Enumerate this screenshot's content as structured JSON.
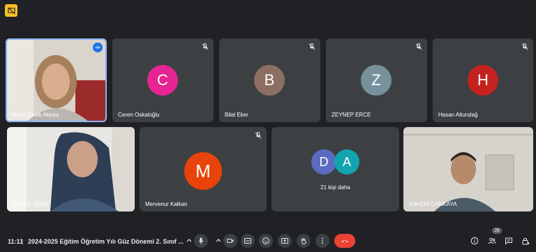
{
  "tiles": [
    {
      "name": "Seher Çevik Aktura"
    },
    {
      "name": "Ceren Oskaloğlu",
      "initial": "C",
      "color": "#e52592"
    },
    {
      "name": "Bilal Eker",
      "initial": "B",
      "color": "#8d6e63"
    },
    {
      "name": "ZEYNEP ERCE",
      "initial": "Z",
      "color": "#78909c"
    },
    {
      "name": "Hasan Altundağ",
      "initial": "H",
      "color": "#c5221f"
    },
    {
      "name": "GÜLLÜ YEŞİL"
    },
    {
      "name": "Mervenur Kalkan",
      "initial": "M",
      "color": "#e8430a"
    },
    {
      "initials": [
        "D",
        "A"
      ],
      "colors": [
        "#5c6bc0",
        "#12a4af"
      ],
      "more_label": "21 kişi daha"
    },
    {
      "name": "ASKERİ ÇANKAYA"
    }
  ],
  "bottombar": {
    "time": "11:11",
    "separator": "|",
    "meeting_title": "2024-2025 Eğitim Öğretim Yılı Güz Dönemi 2. Sınıf ...",
    "participant_count": "29"
  },
  "colors": {
    "background": "#202124",
    "tile": "#3c4043",
    "accent_blue": "#8ab4f8",
    "hangup_red": "#ea4335"
  }
}
